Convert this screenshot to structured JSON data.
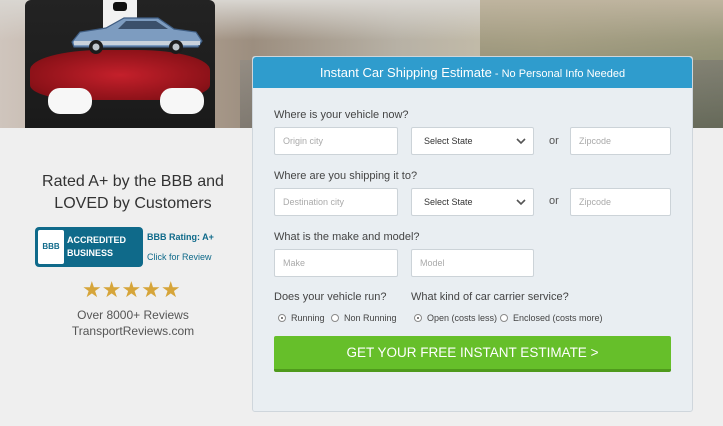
{
  "hero": {
    "icons": [
      "car-icon",
      "pillow-icon",
      "butler-icon"
    ]
  },
  "left": {
    "rated_line1": "Rated A+ by the BBB and",
    "rated_line2": "LOVED by Customers",
    "bbb_seal": "BBB",
    "bbb_accredited_line1": "ACCREDITED",
    "bbb_accredited_line2": "BUSINESS",
    "bbb_rating": "BBB Rating: A+",
    "bbb_click": "Click for Review",
    "stars": "★★★★★",
    "star_rating": 5,
    "reviews_line1": "Over 8000+ Reviews",
    "reviews_line2": "TransportReviews.com"
  },
  "form": {
    "title": "Instant Car Shipping Estimate",
    "title_sep": " - ",
    "subtitle": "No Personal Info Needed",
    "q_origin": "Where is your vehicle now?",
    "origin_city_placeholder": "Origin city",
    "origin_state": "Select State",
    "or": "or",
    "origin_zip_placeholder": "Zipcode",
    "q_dest": "Where are you shipping it to?",
    "dest_city_placeholder": "Destination city",
    "dest_state": "Select State",
    "dest_zip_placeholder": "Zipcode",
    "q_vehicle": "What is the make and model?",
    "make_placeholder": "Make",
    "model_placeholder": "Model",
    "q_runs": "Does your vehicle run?",
    "running": "Running",
    "non_running": "Non Running",
    "q_carrier": "What kind of car carrier service?",
    "open": "Open (costs less)",
    "enclosed": "Enclosed (costs more)",
    "cta": "GET YOUR FREE INSTANT ESTIMATE  >"
  },
  "colors": {
    "header_blue": "#2f9ccd",
    "cta_green": "#66bf2a",
    "bbb_blue": "#0f6a8a"
  }
}
